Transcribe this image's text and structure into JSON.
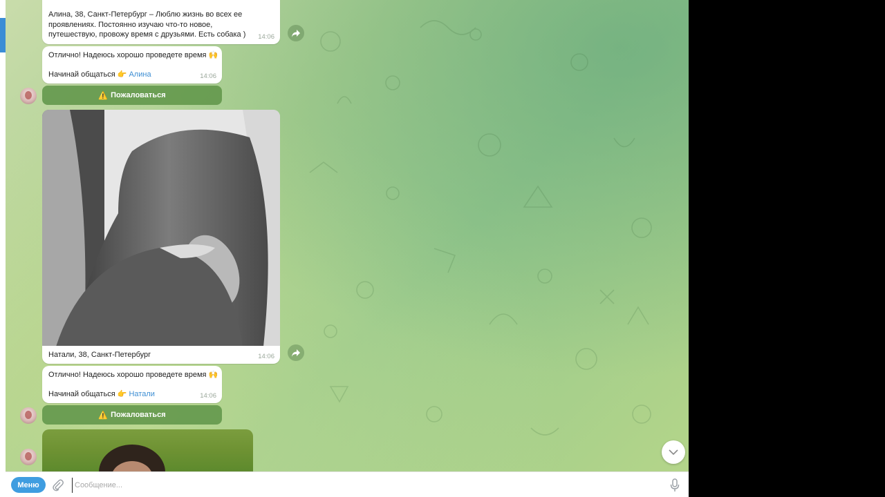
{
  "messages": [
    {
      "text": "Алина, 38, Санкт-Петербург – Люблю жизнь во всех ее проявлениях. Постоянно изучаю что-то новое, путешествую, провожу время с друзьями. Есть собака )",
      "time": "14:06"
    },
    {
      "line1": "Отлично! Надеюсь хорошо проведете время 🙌",
      "line2_prefix": "Начинай общаться 👉 ",
      "link": "Алина",
      "time": "14:06"
    },
    {
      "caption": "Натали, 38, Санкт-Петербург",
      "time": "14:06"
    },
    {
      "line1": "Отлично! Надеюсь хорошо проведете время 🙌",
      "line2_prefix": "Начинай общаться 👉 ",
      "link": "Натали",
      "time": "14:06"
    }
  ],
  "report_label": "Пожаловаться",
  "report_icon": "⚠️",
  "composer": {
    "menu_label": "Меню",
    "placeholder": "Сообщение..."
  }
}
